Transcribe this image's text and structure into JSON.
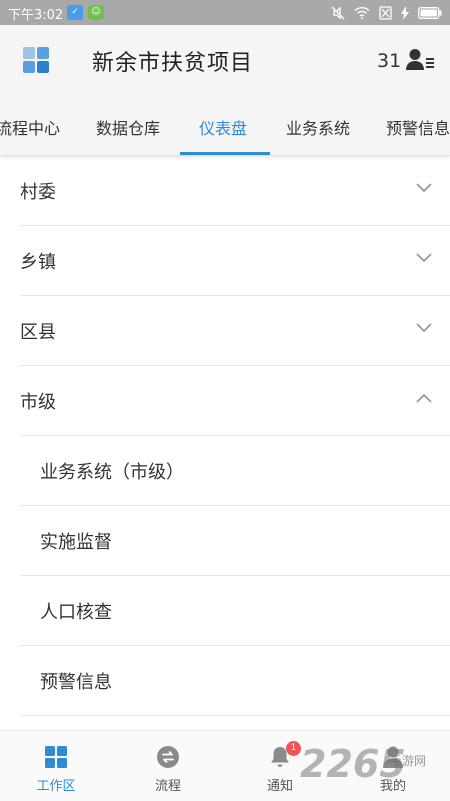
{
  "status_bar": {
    "time": "下午3:02",
    "badge_1": "✓",
    "badge_2": "☺"
  },
  "header": {
    "title": "新余市扶贫项目",
    "user_count": "31"
  },
  "tabs": [
    {
      "label": "流程中心",
      "active": false
    },
    {
      "label": "数据仓库",
      "active": false
    },
    {
      "label": "仪表盘",
      "active": true
    },
    {
      "label": "业务系统",
      "active": false
    },
    {
      "label": "预警信息",
      "active": false
    }
  ],
  "menu": {
    "groups": [
      {
        "label": "村委",
        "expanded": false
      },
      {
        "label": "乡镇",
        "expanded": false
      },
      {
        "label": "区县",
        "expanded": false
      },
      {
        "label": "市级",
        "expanded": true
      }
    ],
    "subitems": [
      {
        "label": "业务系统（市级）"
      },
      {
        "label": "实施监督"
      },
      {
        "label": "人口核查"
      },
      {
        "label": "预警信息"
      }
    ]
  },
  "bottom_nav": [
    {
      "label": "工作区",
      "icon": "grid-icon",
      "active": true
    },
    {
      "label": "流程",
      "icon": "flow-icon",
      "active": false
    },
    {
      "label": "通知",
      "icon": "bell-icon",
      "active": false,
      "badge": "1"
    },
    {
      "label": "我的",
      "icon": "person-icon",
      "active": false
    }
  ],
  "watermark": {
    "big": "2265",
    "small": "手游网"
  },
  "colors": {
    "accent": "#2f8bd6",
    "status_bar": "#a9a9a9",
    "header_bg": "#f5f5f5",
    "badge_red": "#f05454"
  }
}
